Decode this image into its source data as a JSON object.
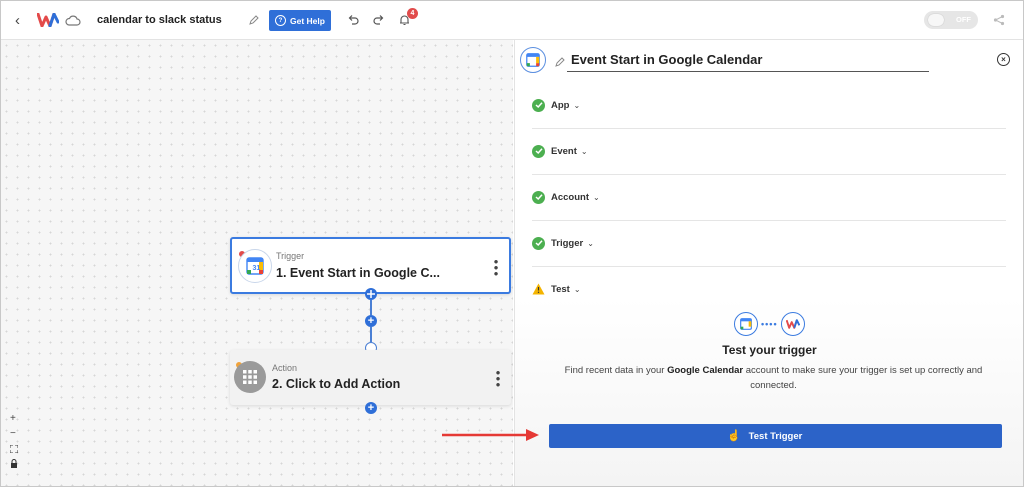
{
  "topbar": {
    "workflow_name": "calendar to slack status",
    "help_label": "Get Help",
    "notification_count": "4",
    "toggle_label": "OFF"
  },
  "canvas": {
    "trigger_node": {
      "kind": "Trigger",
      "title": "1. Event Start in Google C..."
    },
    "action_node": {
      "kind": "Action",
      "title": "2. Click to Add Action"
    },
    "zoom_in": "+",
    "zoom_out": "−"
  },
  "panel": {
    "title": "Event Start in Google Calendar",
    "steps": [
      {
        "label": "App",
        "status": "complete"
      },
      {
        "label": "Event",
        "status": "complete"
      },
      {
        "label": "Account",
        "status": "complete"
      },
      {
        "label": "Trigger",
        "status": "complete"
      },
      {
        "label": "Test",
        "status": "warning"
      }
    ],
    "test": {
      "title": "Test your trigger",
      "desc_pre": "Find recent data in your ",
      "desc_app": "Google Calendar",
      "desc_post": " account to make sure your trigger is set up correctly and connected.",
      "button_label": "Test Trigger"
    }
  },
  "colors": {
    "primary": "#2f6fd8",
    "success": "#4caf50",
    "warning": "#f4b400",
    "arrow": "#e53935"
  }
}
